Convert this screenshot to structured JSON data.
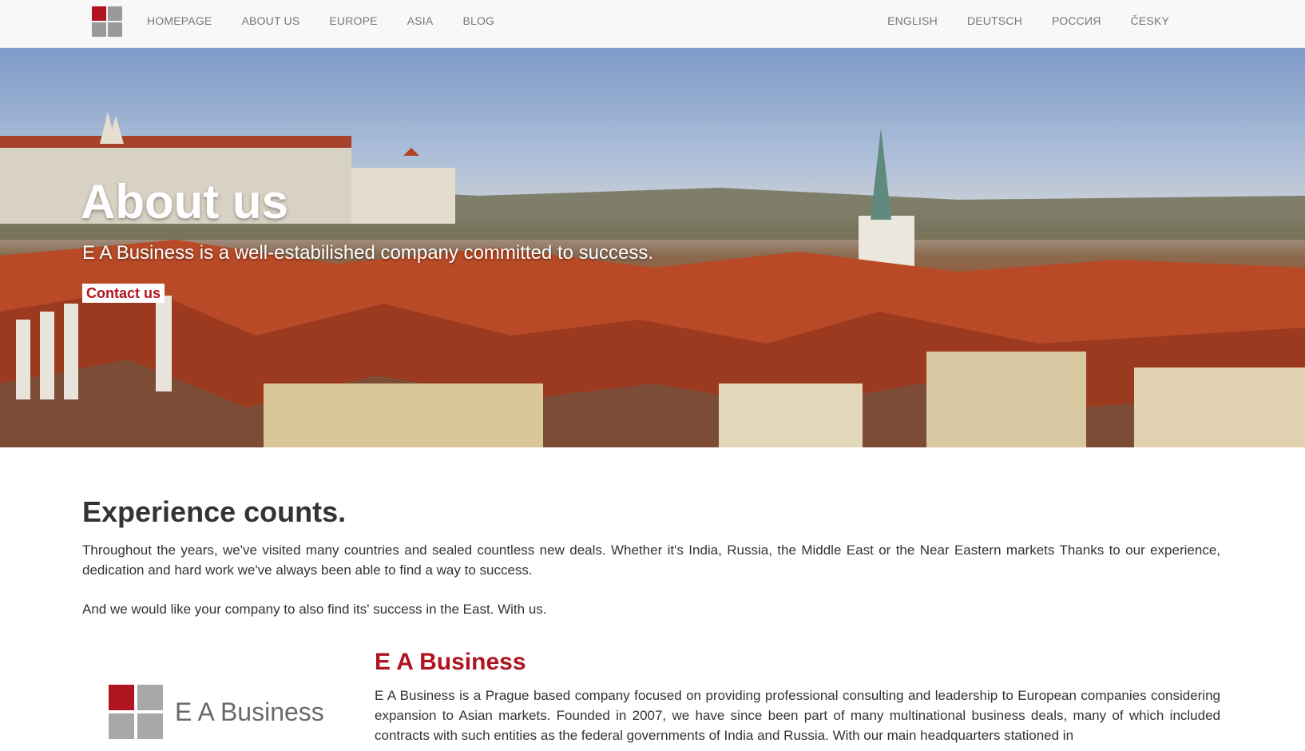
{
  "nav": {
    "left": [
      "HOMEPAGE",
      "ABOUT US",
      "EUROPE",
      "ASIA",
      "BLOG"
    ],
    "right": [
      "ENGLISH",
      "DEUTSCH",
      "РОССИЯ",
      "ČESKY"
    ]
  },
  "hero": {
    "title": "About us",
    "subtitle": "E A Business is a well-estabilished company committed to success.",
    "button": "Contact us"
  },
  "experience": {
    "title": "Experience counts.",
    "p1": "Throughout the years, we've visited many countries and sealed countless new deals. Whether it's India, Russia, the Middle East or the Near Eastern markets Thanks to our experience, dedication and hard work we've always been able to find a way to success.",
    "p2": "And we would like your company to also find its' success in the East. With us."
  },
  "company": {
    "logo_text": "E A Business",
    "title": "E A Business",
    "p": "E A Business is a Prague based company focused on providing professional consulting and leadership to European companies considering expansion to Asian markets. Founded in 2007, we have since been part of many multinational business deals, many of which included contracts with such entities as the federal governments of India and Russia. With our main headquarters stationed in"
  },
  "colors": {
    "accent": "#b0141f",
    "navbar_bg": "#f8f8f8"
  }
}
